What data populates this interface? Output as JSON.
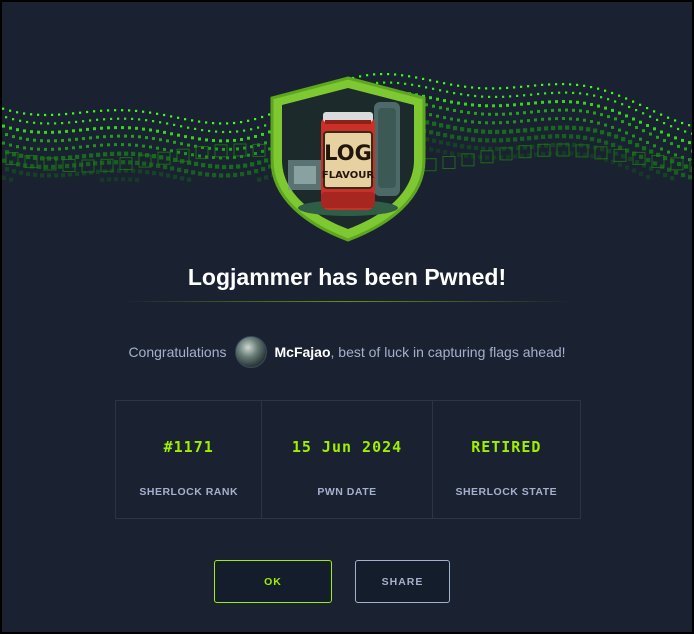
{
  "modal": {
    "title": "Logjammer has been Pwned!",
    "congrats_prefix": "Congratulations",
    "username": "McFajao",
    "congrats_suffix": ", best of luck in capturing flags ahead!"
  },
  "badge": {
    "jar_line1": "LOG",
    "jar_line2": "FLAVOUR"
  },
  "stats": [
    {
      "value": "#1171",
      "label": "SHERLOCK RANK"
    },
    {
      "value": "15 Jun 2024",
      "label": "PWN DATE"
    },
    {
      "value": "RETIRED",
      "label": "SHERLOCK STATE"
    }
  ],
  "buttons": {
    "ok": "OK",
    "share": "SHARE"
  },
  "colors": {
    "accent": "#9fef00",
    "background": "#1a2232",
    "muted": "#a4b1cd"
  }
}
